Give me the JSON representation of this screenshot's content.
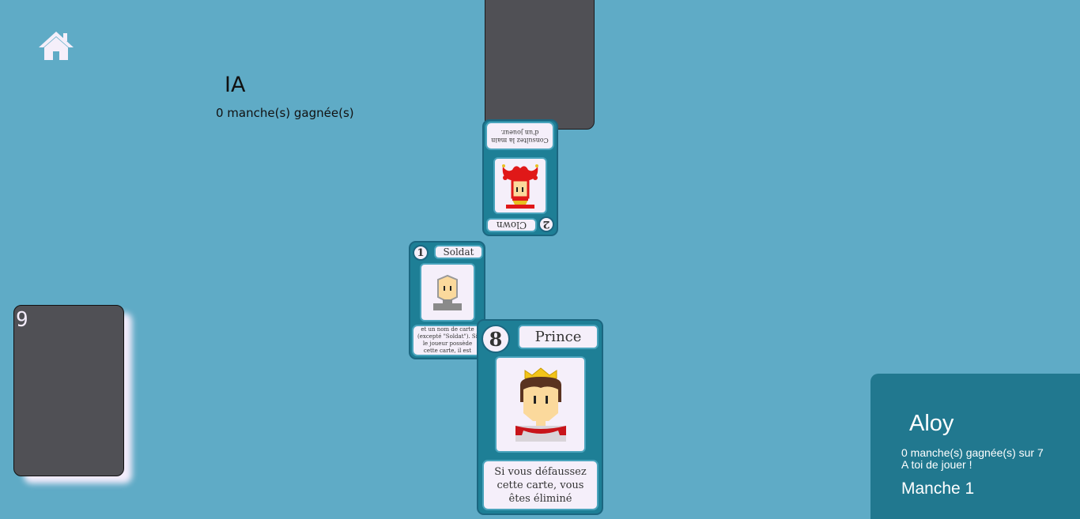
{
  "opponent": {
    "name": "IA",
    "score": "0 manche(s) gagnée(s)"
  },
  "deck": {
    "count": "9"
  },
  "played_cards": [
    {
      "number": "2",
      "name": "Clown",
      "description": "Consultez la main d'un joueur.",
      "icon": "clown-icon"
    },
    {
      "number": "1",
      "name": "Soldat",
      "description": "Choisissez un joueur et un nom de carte (excepté \"Soldat\"). Si le joueur possède cette carte, il est éliminé",
      "icon": "soldier-icon"
    }
  ],
  "hand_card": {
    "number": "8",
    "name": "Prince",
    "description": "Si vous défaussez cette carte, vous êtes éliminé",
    "icon": "prince-icon"
  },
  "player": {
    "name": "Aloy",
    "score": "0 manche(s) gagnée(s) sur 7",
    "turn_message": "A toi de jouer !",
    "round": "Manche 1"
  },
  "colors": {
    "background": "#5fabc6",
    "panel": "#21788f",
    "card": "#1e7f96",
    "card_back": "#505055"
  }
}
